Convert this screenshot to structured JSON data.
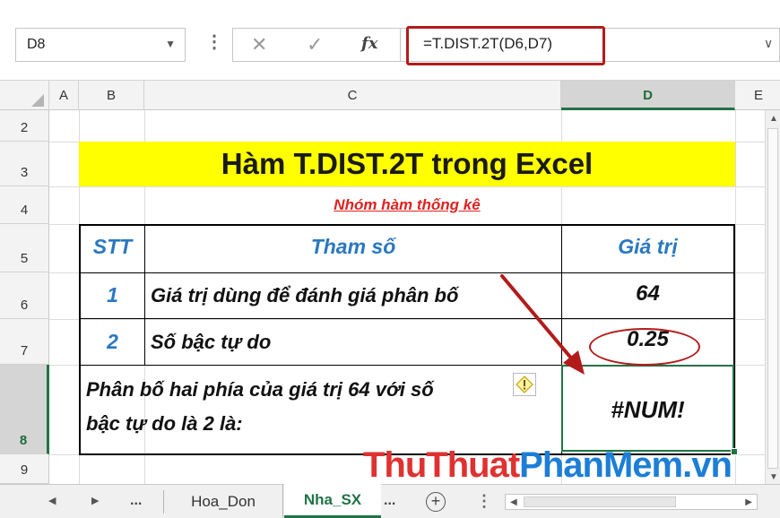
{
  "formula_bar": {
    "name_box": "D8",
    "formula": "=T.DIST.2T(D6,D7)",
    "dots": "⋮",
    "cancel_glyph": "✕",
    "enter_glyph": "✓",
    "fx_label": "fx"
  },
  "columns": [
    "A",
    "B",
    "C",
    "D",
    "E"
  ],
  "rows": [
    "2",
    "3",
    "4",
    "5",
    "6",
    "7",
    "8",
    "9"
  ],
  "sheet": {
    "title": "Hàm T.DIST.2T trong Excel",
    "subtitle": "Nhóm hàm thống kê",
    "headers": {
      "stt": "STT",
      "param": "Tham số",
      "value": "Giá trị"
    },
    "rows": [
      {
        "stt": "1",
        "param": "Giá trị dùng để đánh giá phân bố",
        "value": "64"
      },
      {
        "stt": "2",
        "param": "Số bậc tự do",
        "value": "0.25"
      }
    ],
    "result_label_line1": "Phân bố hai phía của giá trị 64 với số",
    "result_label_line2": "bậc tự do là 2 là:",
    "result_value": "#NUM!"
  },
  "tabs": {
    "more": "...",
    "items": [
      "Hoa_Don",
      "Nha_SX"
    ],
    "active": "Nha_SX",
    "add": "+",
    "menu": "⋮"
  },
  "watermark": {
    "part1": "ThuThuat",
    "part2": "PhanMem.vn"
  },
  "colors": {
    "accent_green": "#217346",
    "title_fill": "#ffff00",
    "subtitle_red": "#e02020",
    "header_blue": "#2a78c0",
    "annotation_red": "#b31b1b"
  },
  "icons": [
    "cancel-icon",
    "enter-icon",
    "fx-icon",
    "chevron-down-icon",
    "warning-icon",
    "add-sheet-icon",
    "arrow-left-icon",
    "arrow-right-icon"
  ]
}
